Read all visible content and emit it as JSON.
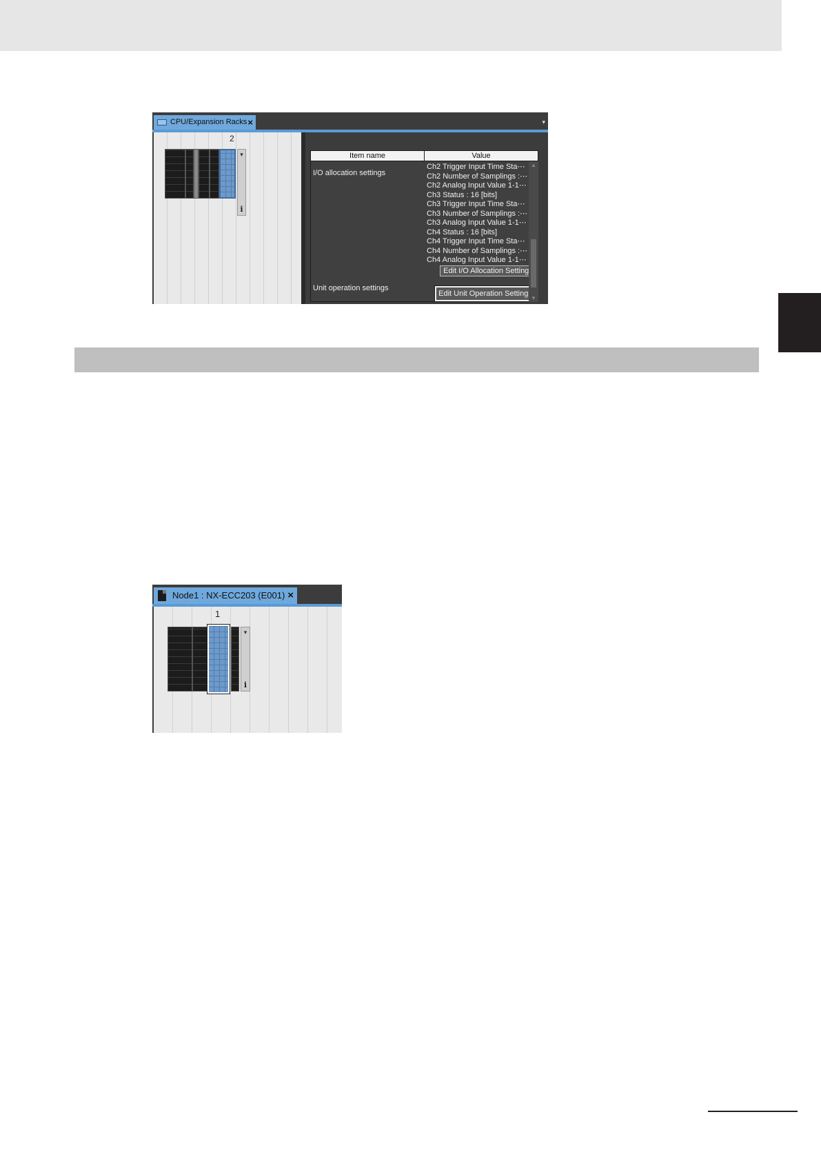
{
  "screen1": {
    "tab_label": "CPU/Expansion Racks",
    "tab_close": "×",
    "tab_menu_arrow": "▾",
    "rack_slot_number": "2",
    "rack_scroll_arrow": "▾",
    "rack_info_icon": "i",
    "table": {
      "col_item": "Item name",
      "col_value": "Value",
      "io_label": "I/O allocation settings",
      "io_values": [
        "Ch2 Trigger Input Time Sta⋯",
        "Ch2 Number of Samplings :⋯",
        "Ch2 Analog Input Value 1-1⋯",
        "Ch3 Status : 16 [bits]",
        "Ch3 Trigger Input Time Sta⋯",
        "Ch3 Number of Samplings :⋯",
        "Ch3 Analog Input Value 1-1⋯",
        "Ch4 Status : 16 [bits]",
        "Ch4 Trigger Input Time Sta⋯",
        "Ch4 Number of Samplings :⋯",
        "Ch4 Analog Input Value 1-1⋯"
      ],
      "edit_io_button": "Edit I/O Allocation Settings",
      "unit_op_label": "Unit operation settings",
      "edit_unit_op_button": "Edit Unit Operation Settings"
    }
  },
  "screen2": {
    "tab_label": "Node1 : NX-ECC203 (E001)",
    "tab_close": "×",
    "rack_slot_number": "1",
    "rack_scroll_arrow": "▾",
    "rack_info_icon": "i"
  },
  "colors": {
    "tab_blue": "#6fa8dc",
    "selected_unit_blue": "#6e99c9",
    "dark_panel": "#3c3c3c",
    "side_tab": "#231f20"
  }
}
